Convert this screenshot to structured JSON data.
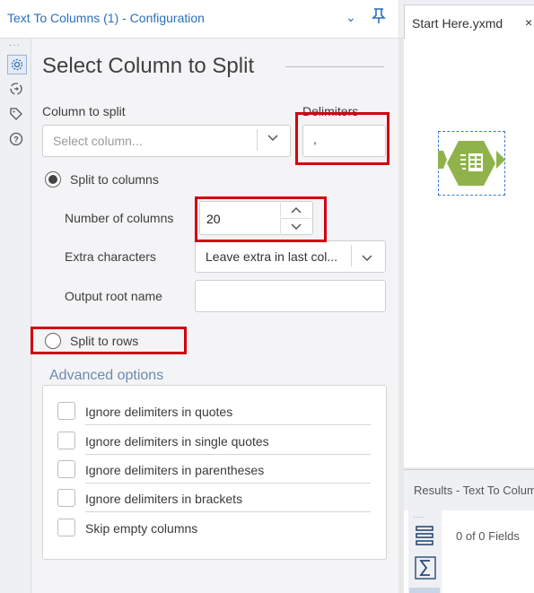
{
  "config": {
    "title": "Text To Columns (1) - Configuration",
    "section_title": "Select Column to Split",
    "column_to_split_label": "Column to split",
    "column_select_placeholder": "Select column...",
    "delimiters_label": "Delimiters",
    "delimiters_value": ",",
    "split_to_columns_label": "Split to columns",
    "split_to_columns_selected": true,
    "number_of_columns_label": "Number of columns",
    "number_of_columns_value": "20",
    "extra_characters_label": "Extra characters",
    "extra_characters_value": "Leave extra in last col...",
    "output_root_name_label": "Output root name",
    "output_root_name_value": "",
    "split_to_rows_label": "Split to rows",
    "split_to_rows_selected": false,
    "advanced_options_label": "Advanced options",
    "advanced_options": [
      {
        "label": "Ignore delimiters in quotes",
        "checked": false
      },
      {
        "label": "Ignore delimiters in single quotes",
        "checked": false
      },
      {
        "label": "Ignore delimiters in parentheses",
        "checked": false
      },
      {
        "label": "Ignore delimiters in brackets",
        "checked": false
      },
      {
        "label": "Skip empty columns",
        "checked": false
      }
    ]
  },
  "rail_icons": [
    "gear-icon",
    "connection-icon",
    "tag-icon",
    "help-icon"
  ],
  "canvas": {
    "tab_label": "Start Here.yxmd",
    "tab_close": "×",
    "tool_icon": "text-to-columns-tool-icon"
  },
  "results": {
    "label": "Results - Text To Columns",
    "fields_text": "0 of 0 Fields"
  },
  "colors": {
    "accent": "#2d6fb8",
    "highlight_red": "#d00010",
    "tool_green": "#8fb34a"
  }
}
